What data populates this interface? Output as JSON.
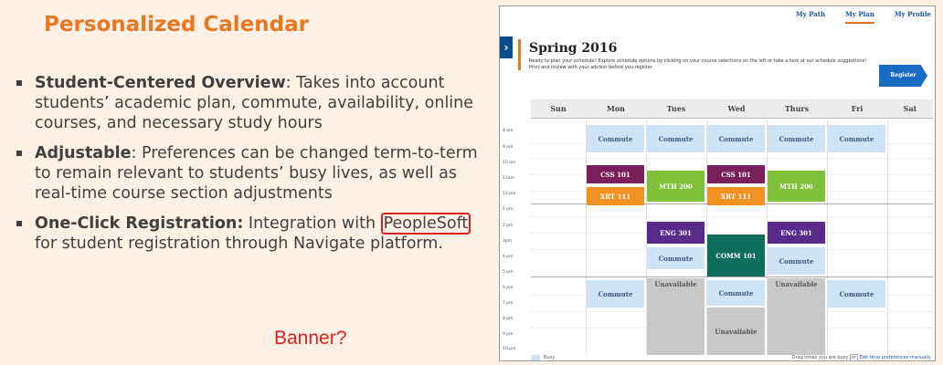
{
  "slide": {
    "title": "Personalized Calendar",
    "bullets": [
      {
        "bold": "Student-Centered Overview",
        "text": ": Takes into account students’ academic plan, commute, availability, online courses, and necessary study hours"
      },
      {
        "bold": "Adjustable",
        "text": ": Preferences can be changed term-to-term to remain relevant to students’ busy lives, as well as real-time course section adjustments"
      },
      {
        "bold": "One-Click Registration:",
        "text_before": " Integration with ",
        "circled": "PeopleSoft",
        "text_after": " for student registration through Navigate platform."
      }
    ],
    "note": "Banner?"
  },
  "app": {
    "nav": [
      "My Path",
      "My Plan",
      "My Profile"
    ],
    "active_nav": "My Plan",
    "back_glyph": "›",
    "term": "Spring 2016",
    "intro": "Ready to plan your schedule? Explore schedule options by clicking on your course selections on the left or take a look at our schedule suggestions! Print and review with your advisor before you register.",
    "register_label": "Register",
    "days": [
      "Sun",
      "Mon",
      "Tues",
      "Wed",
      "Thurs",
      "Fri",
      "Sat"
    ],
    "times": [
      "8 am",
      "9 am",
      "10 am",
      "11am",
      "12 pm",
      "1 pm",
      "2 pm",
      "3pm",
      "4 pm",
      "5 pm",
      "6 pm",
      "7 pm",
      "8 pm",
      "9 pm",
      "10 pm"
    ],
    "events": {
      "mon_commute_am": "Commute",
      "tue_commute_am": "Commute",
      "wed_commute_am": "Commute",
      "thu_commute_am": "Commute",
      "fri_commute_am": "Commute",
      "mon_css": "CSS 101",
      "mon_xrt": "XRT 111",
      "tue_mth": "MTH 200",
      "wed_css": "CSS 101",
      "wed_xrt": "XRT 111",
      "thu_mth": "MTH 200",
      "tue_eng": "ENG 301",
      "thu_eng": "ENG 301",
      "tue_commute_pm1": "Commute",
      "wed_comm": "COMM 101",
      "thu_commute_pm1": "Commute",
      "mon_commute_pm": "Commute",
      "tue_unavail": "Unavailable",
      "wed_commute_pm": "Commute",
      "wed_unavail": "Unavailable",
      "thu_unavail": "Unavailable",
      "fri_commute_pm": "Commute"
    },
    "legend": "Busy",
    "footer_text": "Drag times you are busy",
    "footer_or": "or",
    "footer_link": "Edit time preferences manually"
  }
}
